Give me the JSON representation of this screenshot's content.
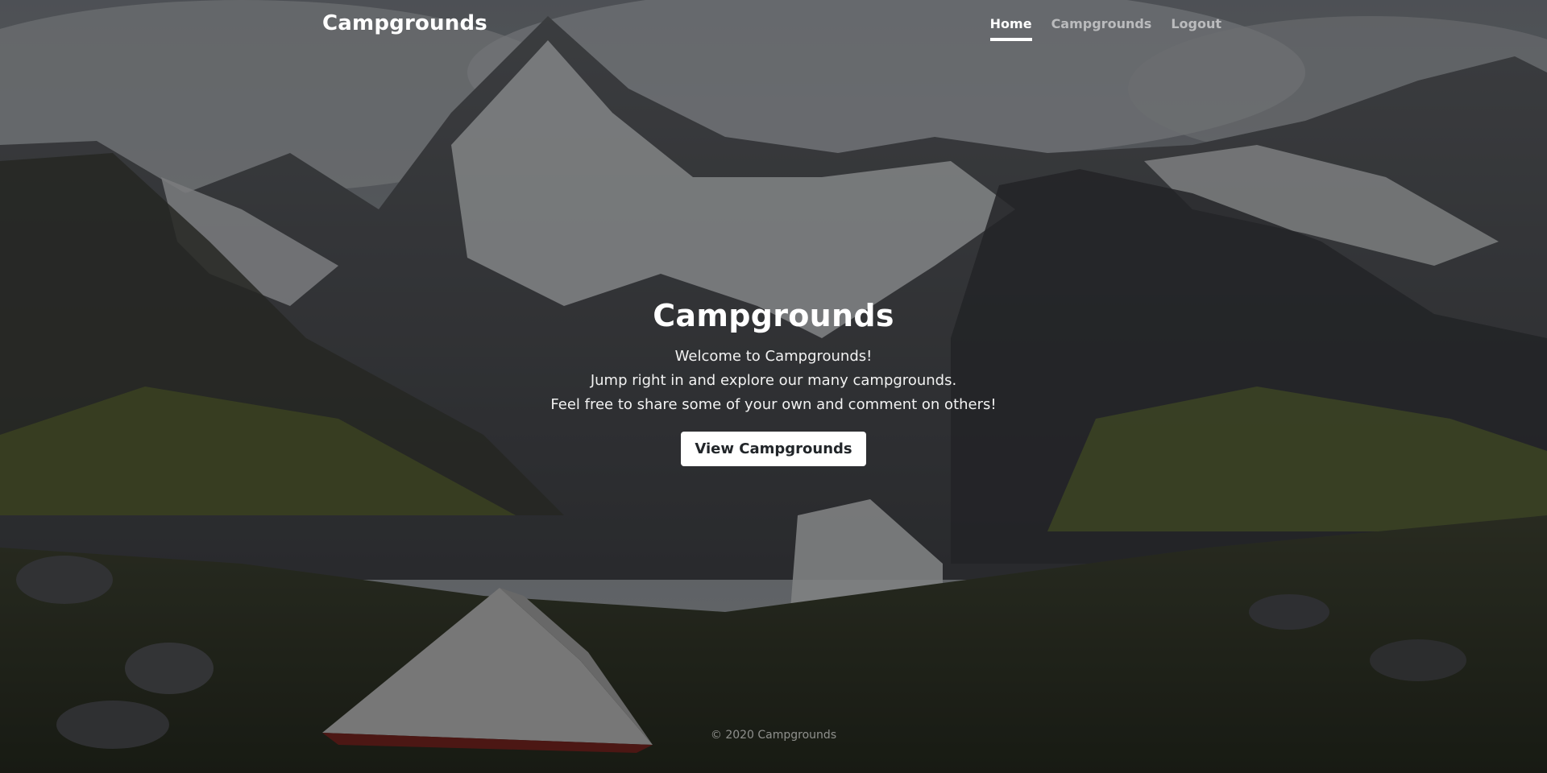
{
  "navbar": {
    "brand": "Campgrounds",
    "links": [
      {
        "label": "Home",
        "active": true
      },
      {
        "label": "Campgrounds",
        "active": false
      },
      {
        "label": "Logout",
        "active": false
      }
    ]
  },
  "hero": {
    "title": "Campgrounds",
    "lines": [
      "Welcome to Campgrounds!",
      "Jump right in and explore our many campgrounds.",
      "Feel free to share some of your own and comment on others!"
    ],
    "button_label": "View Campgrounds"
  },
  "footer": {
    "text": "© 2020 Campgrounds"
  },
  "background": {
    "scene": "mountain-campsite-photo",
    "overlay_color": "#000000"
  }
}
